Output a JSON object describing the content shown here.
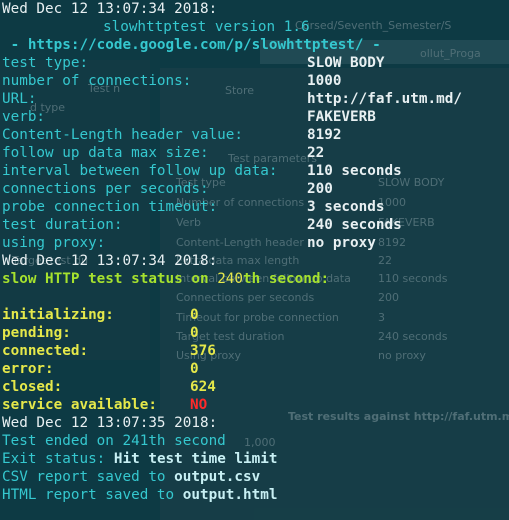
{
  "background_window": {
    "breadcrumb": "Cursed/Seventh_Semester/S",
    "tab_label": "ollut_Proga",
    "menu_item": "Store",
    "side_label_1": "Test n",
    "side_label_2": "d type",
    "side_label_3": "Target test du",
    "panel_header": "Test parameters",
    "params": [
      {
        "label": "Test type",
        "value": "SLOW BODY"
      },
      {
        "label": "Number of connections",
        "value": "1000"
      },
      {
        "label": "Verb",
        "value": "FAKEVERB"
      },
      {
        "label": "Content-Length header",
        "value": "8192"
      },
      {
        "label": "Extra data max length",
        "value": "22"
      },
      {
        "label": "Interval between follow up data",
        "value": "110 seconds"
      },
      {
        "label": "Connections per seconds",
        "value": "200"
      },
      {
        "label": "Timeout for probe connection",
        "value": "3"
      },
      {
        "label": "Target test duration",
        "value": "240 seconds"
      },
      {
        "label": "Using proxy",
        "value": "no proxy"
      }
    ],
    "chart_title": "Test results against http://faf.utm.md/",
    "chart_tick": "1,000"
  },
  "terminal": {
    "header_time": "Wed Dec 12 13:07:34 2018:",
    "version_line": "slowhttptest version 1.6",
    "url_line": " - https://code.google.com/p/slowhttptest/ -",
    "config": [
      {
        "label": "test type:",
        "value": "SLOW BODY"
      },
      {
        "label": "number of connections:",
        "value": "1000"
      },
      {
        "label": "URL:",
        "value": "http://faf.utm.md/"
      },
      {
        "label": "verb:",
        "value": "FAKEVERB"
      },
      {
        "label": "Content-Length header value:",
        "value": "8192"
      },
      {
        "label": "follow up data max size:",
        "value": "22"
      },
      {
        "label": "interval between follow up data:",
        "value": "110 seconds"
      },
      {
        "label": "connections per seconds:",
        "value": "200"
      },
      {
        "label": "probe connection timeout:",
        "value": "3 seconds"
      },
      {
        "label": "test duration:",
        "value": "240 seconds"
      },
      {
        "label": "using proxy:",
        "value": "no proxy"
      }
    ],
    "status_time": "Wed Dec 12 13:07:34 2018:",
    "status_prefix": "slow HTTP test status on ",
    "status_second": "240",
    "status_suffix": "th second:",
    "counters": [
      {
        "label": "initializing:",
        "value": "0"
      },
      {
        "label": "pending:",
        "value": "0"
      },
      {
        "label": "connected:",
        "value": "376"
      },
      {
        "label": "error:",
        "value": "0"
      },
      {
        "label": "closed:",
        "value": "624"
      }
    ],
    "service_label": "service available:",
    "service_value": "NO",
    "end_time": "Wed Dec 12 13:07:35 2018:",
    "ended_line": "Test ended on 241th second",
    "exit_label": "Exit status: ",
    "exit_value": "Hit test time limit",
    "csv_label": "CSV report saved to ",
    "csv_file": "output.csv",
    "html_label": "HTML report saved to ",
    "html_file": "output.html"
  }
}
